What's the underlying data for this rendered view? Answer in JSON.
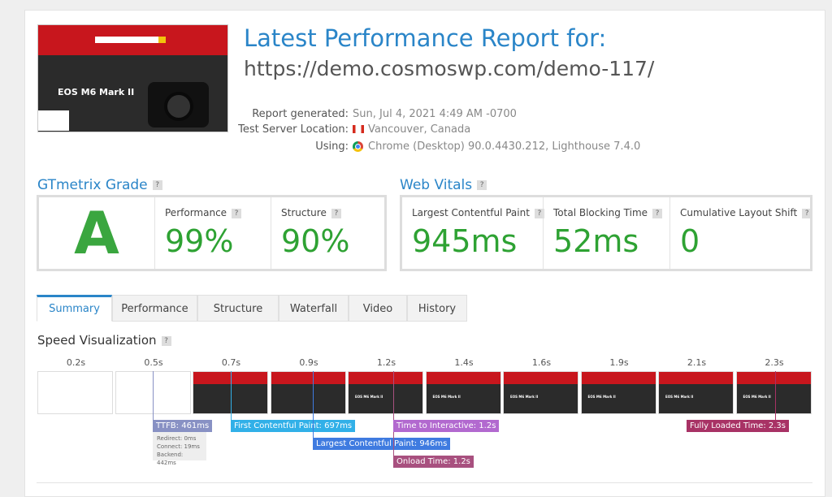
{
  "header": {
    "title": "Latest Performance Report for:",
    "url": "https://demo.cosmoswp.com/demo-117/",
    "thumbnail": {
      "hero_text": "EOS M6 Mark II"
    },
    "meta": [
      {
        "label": "Report generated:",
        "value": "Sun, Jul 4, 2021 4:49 AM -0700",
        "icon": ""
      },
      {
        "label": "Test Server Location:",
        "value": "Vancouver, Canada",
        "icon": "canada-flag-icon"
      },
      {
        "label": "Using:",
        "value": "Chrome (Desktop) 90.0.4430.212, Lighthouse 7.4.0",
        "icon": "chrome-icon"
      }
    ]
  },
  "grade": {
    "title": "GTmetrix Grade",
    "letter": "A",
    "performance_label": "Performance",
    "performance": "99%",
    "structure_label": "Structure",
    "structure": "90%",
    "color": "#2ea233"
  },
  "vitals": {
    "title": "Web Vitals",
    "items": [
      {
        "label": "Largest Contentful Paint",
        "value": "945ms"
      },
      {
        "label": "Total Blocking Time",
        "value": "52ms"
      },
      {
        "label": "Cumulative Layout Shift",
        "value": "0"
      }
    ]
  },
  "tabs": [
    "Summary",
    "Performance",
    "Structure",
    "Waterfall",
    "Video",
    "History"
  ],
  "speed": {
    "title": "Speed Visualization",
    "times": [
      "0.2s",
      "0.5s",
      "0.7s",
      "0.9s",
      "1.2s",
      "1.4s",
      "1.6s",
      "1.9s",
      "2.1s",
      "2.3s"
    ],
    "markers": {
      "ttfb": "TTFB: 461ms",
      "fcp": "First Contentful Paint: 697ms",
      "lcp": "Largest Contentful Paint: 946ms",
      "tti": "Time to Interactive: 1.2s",
      "onload": "Onload Time: 1.2s",
      "fully": "Fully Loaded Time: 2.3s"
    },
    "ttfb_breakdown": [
      "Redirect: 0ms",
      "Connect: 19ms",
      "Backend: 442ms"
    ]
  }
}
